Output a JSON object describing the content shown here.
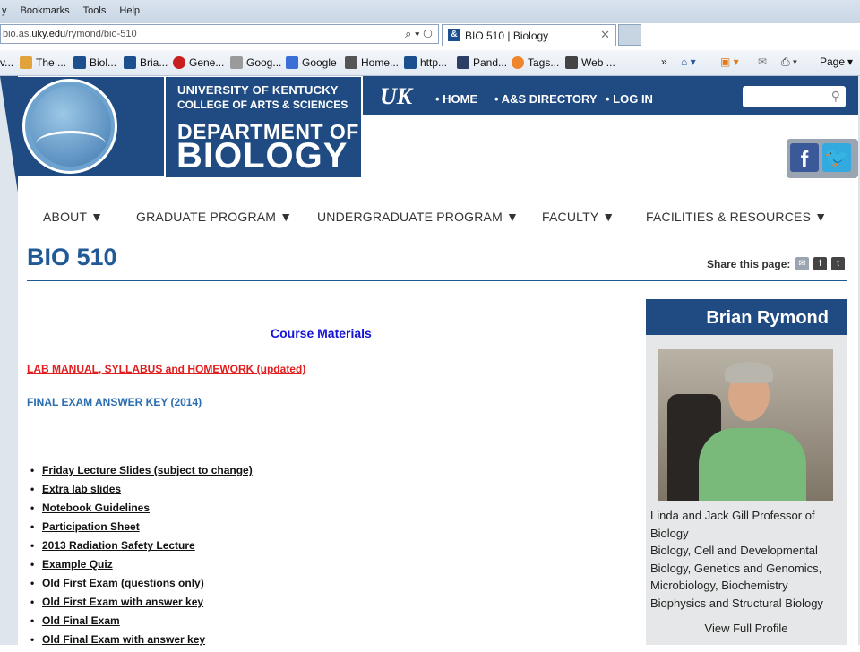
{
  "browser": {
    "menu": [
      "y",
      "Bookmarks",
      "Tools",
      "Help"
    ],
    "url_prefix": "bio.as.",
    "url_domain": "uky.edu",
    "url_path": "/rymond/bio-510",
    "url_controls": "⌕ ▾ ↻",
    "tab_title": "BIO 510 | Biology",
    "tab_close": "✕",
    "favorites": [
      "v...",
      "The ...",
      "Biol...",
      "Bria...",
      "Gene...",
      "Goog...",
      "Google",
      "Home...",
      "http...",
      "Pand...",
      "Tags...",
      "Web ..."
    ],
    "favorites_more": "»",
    "page_menu": "Page"
  },
  "header": {
    "university_line1": "UNIVERSITY OF KENTUCKY",
    "university_line2": "COLLEGE OF ARTS & SCIENCES",
    "department_line1": "DEPARTMENT OF",
    "department_line2": "BIOLOGY",
    "uk_logo": "UK",
    "top_nav": [
      "• HOME",
      "• A&S DIRECTORY",
      "• LOG IN"
    ]
  },
  "main_nav": [
    "ABOUT ▼",
    "GRADUATE PROGRAM ▼",
    "UNDERGRADUATE PROGRAM ▼",
    "FACULTY ▼",
    "FACILITIES & RESOURCES ▼"
  ],
  "page": {
    "title": "BIO 510",
    "share_label": "Share this page:",
    "course_materials": "Course Materials",
    "lab_manual_link": "LAB MANUAL, SYLLABUS and HOMEWORK (updated)",
    "final_key_link": "FINAL EXAM ANSWER KEY (2014)",
    "bullet": "•",
    "links": [
      "Friday Lecture Slides (subject to change)",
      "Extra lab slides",
      "Notebook Guidelines",
      "Participation Sheet",
      "2013 Radiation Safety Lecture",
      "Example Quiz",
      "Old First Exam (questions only)",
      "Old First Exam with answer key",
      "Old Final Exam",
      "Old Final Exam with answer key"
    ]
  },
  "profile": {
    "name": "Brian Rymond",
    "title_lines": [
      "Linda and Jack Gill Professor of",
      "Biology",
      "Biology, Cell and Developmental",
      "Biology, Genetics and Genomics,",
      "Microbiology, Biochemistry",
      "Biophysics and Structural Biology"
    ],
    "view_profile": "View Full Profile"
  },
  "icons": {
    "facebook": "f",
    "twitter": "t",
    "search": "⚲",
    "email": "✉"
  },
  "colors": {
    "uk_blue": "#1f4a82",
    "title_blue": "#1f5a96",
    "course_materials_blue": "#1414d6",
    "lab_manual_red": "#e21d1d"
  }
}
